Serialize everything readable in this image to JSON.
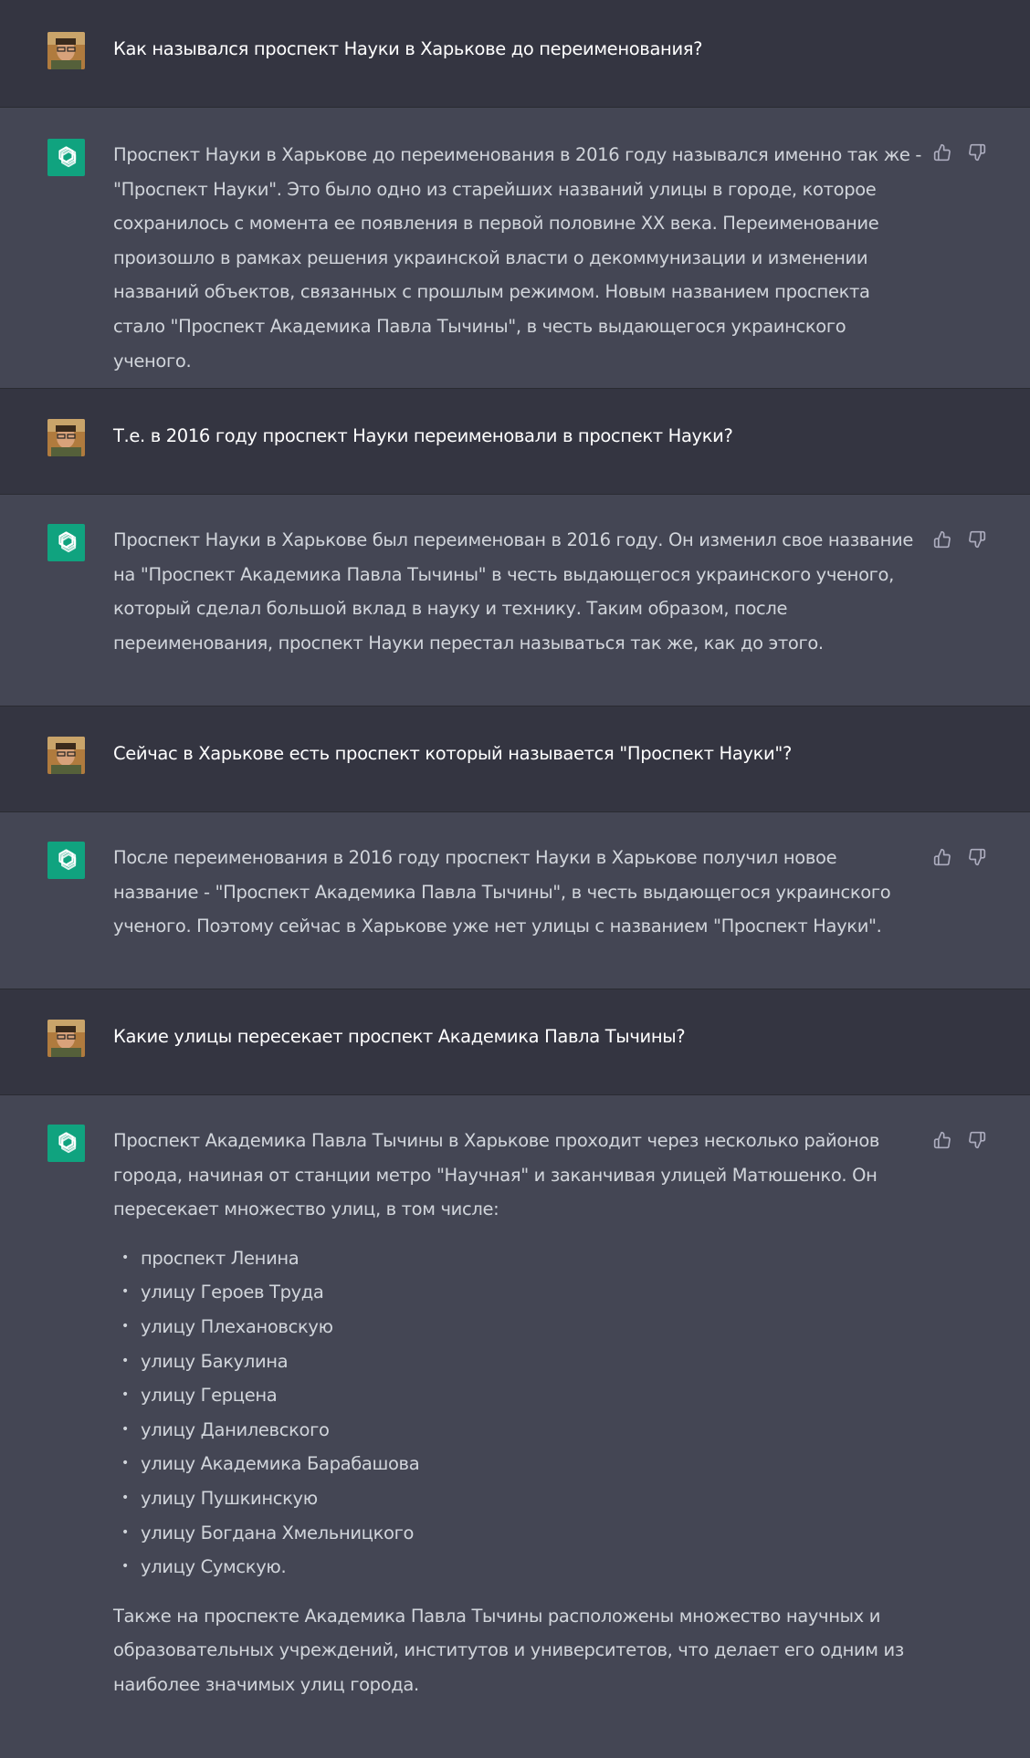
{
  "colors": {
    "user_bg": "#343541",
    "bot_bg": "#444654",
    "bot_logo_bg": "#10a37f",
    "user_text": "#ffffff",
    "bot_text": "#d1d5db",
    "icon_color": "#acacbe"
  },
  "messages": [
    {
      "role": "user",
      "text": "Как назывался проспект Науки в Харькове до переименования?"
    },
    {
      "role": "assistant",
      "lines": [
        "Проспект Науки в Харькове до переименования в 2016 году назывался именно так же -",
        "\"Проспект Науки\". Это было одно из старейших названий улицы в городе, которое",
        "сохранилось с момента ее появления в первой половине XX века. Переименование",
        "произошло в рамках решения украинской власти о декоммунизации и изменении",
        "названий объектов, связанных с прошлым режимом. Новым названием проспекта",
        "стало \"Проспект Академика Павла Тычины\", в честь выдающегося украинского ученого."
      ]
    },
    {
      "role": "user",
      "text": "Т.е. в 2016 году проспект Науки переименовали в проспект Науки?"
    },
    {
      "role": "assistant",
      "lines": [
        "Проспект Науки в Харькове был переименован в 2016 году. Он изменил свое название",
        "на \"Проспект Академика Павла Тычины\" в честь выдающегося украинского ученого,",
        "который сделал большой вклад в науку и технику. Таким образом, после",
        "переименования, проспект Науки перестал называться так же, как до этого."
      ]
    },
    {
      "role": "user",
      "text": "Сейчас в Харькове есть проспект который называется \"Проспект Науки\"?"
    },
    {
      "role": "assistant",
      "lines": [
        "После переименования в 2016 году проспект Науки в Харькове получил новое",
        "название - \"Проспект Академика Павла Тычины\", в честь выдающегося украинского",
        "ученого. Поэтому сейчас в Харькове уже нет улицы с названием \"Проспект Науки\"."
      ]
    },
    {
      "role": "user",
      "text": "Какие улицы пересекает проспект Академика Павла Тычины?"
    },
    {
      "role": "assistant",
      "intro_lines": [
        "Проспект Академика Павла Тычины в Харькове проходит через несколько районов",
        "города, начиная от станции метро \"Научная\" и заканчивая улицей Матюшенко. Он",
        "пересекает множество улиц, в том числе:"
      ],
      "list": [
        "проспект Ленина",
        "улицу Героев Труда",
        "улицу Плехановскую",
        "улицу Бакулина",
        "улицу Герцена",
        "улицу Данилевского",
        "улицу Академика Барабашова",
        "улицу Пушкинскую",
        "улицу Богдана Хмельницкого",
        "улицу Сумскую."
      ],
      "outro_lines": [
        "Также на проспекте Академика Павла Тычины расположены множество научных и",
        "образовательных учреждений, институтов и университетов, что делает его одним из",
        "наиболее значимых улиц города."
      ]
    }
  ],
  "icons": {
    "user_avatar": "user-avatar",
    "assistant_logo": "openai-logo-icon",
    "thumbs_up": "thumbs-up-icon",
    "thumbs_down": "thumbs-down-icon"
  }
}
